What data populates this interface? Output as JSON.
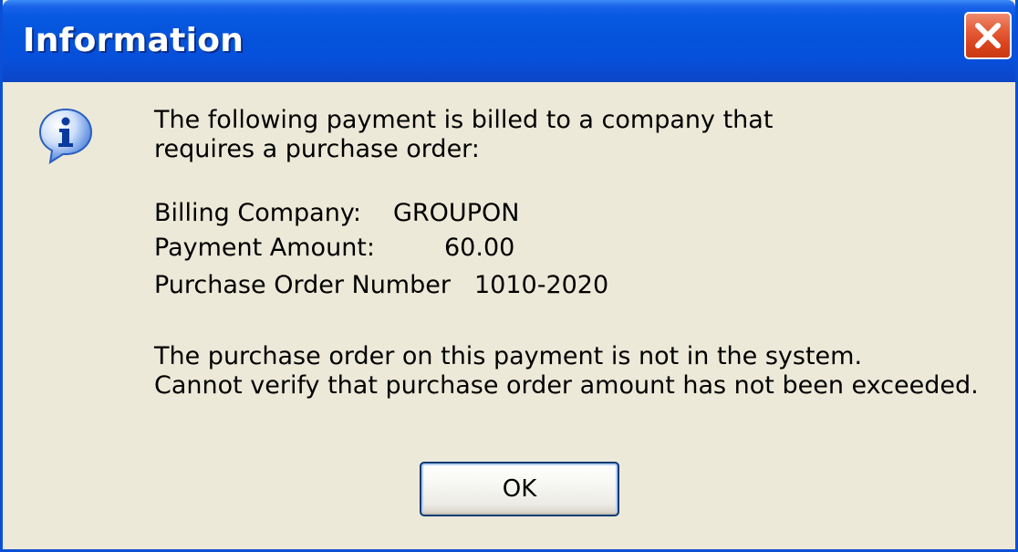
{
  "window": {
    "title": "Information"
  },
  "message": {
    "intro_line_1": "The following payment is billed to a company that",
    "intro_line_2": "requires a purchase order:",
    "fields": [
      {
        "label": "Billing Company:",
        "value": "GROUPON"
      },
      {
        "label": "Payment Amount:",
        "value": "60.00"
      },
      {
        "label": "Purchase Order Number",
        "value": "1010-2020"
      }
    ],
    "warning_line_1": "The purchase order on this payment is not in the system.",
    "warning_line_2": "Cannot verify that purchase order amount has not been exceeded."
  },
  "buttons": {
    "ok_label": "OK"
  },
  "icons": {
    "close": "close-icon",
    "information": "info-icon"
  },
  "colors": {
    "titlebar": "#0553da",
    "dialog_background": "#ece9d8",
    "close_button": "#d9431d",
    "info_icon": "#2f6fd6"
  }
}
